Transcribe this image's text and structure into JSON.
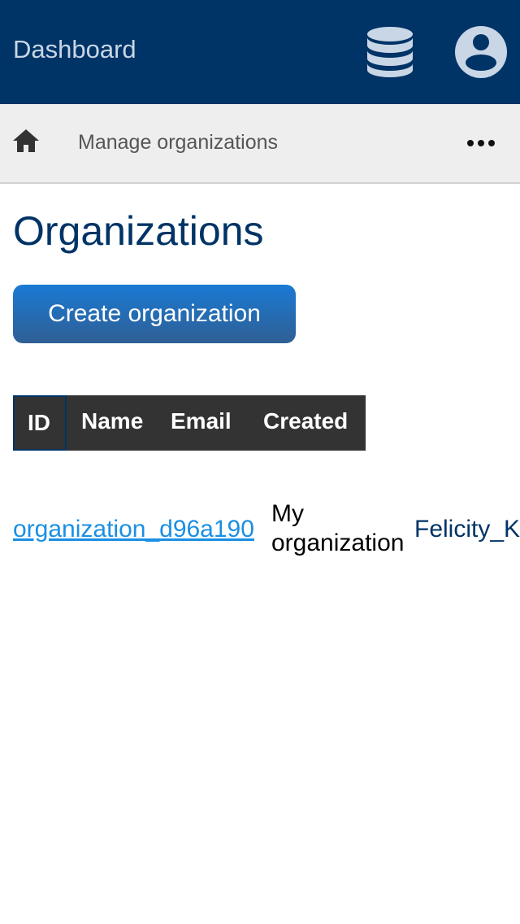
{
  "header": {
    "title": "Dashboard",
    "database_icon": "database-icon",
    "account_icon": "account-circle-icon",
    "background_color": "#003366"
  },
  "breadcrumb": {
    "home_icon": "home-icon",
    "label": "Manage organizations",
    "more_icon": "more-horizontal-icon"
  },
  "main": {
    "title": "Organizations",
    "create_button_label": "Create organization",
    "accent_color": "#1a7ad4"
  },
  "table": {
    "columns": [
      "ID",
      "Name",
      "Email",
      "Created"
    ],
    "rows": [
      {
        "id": "organization_d96a190",
        "name": "My organization",
        "email": "Felicity_K"
      }
    ]
  }
}
